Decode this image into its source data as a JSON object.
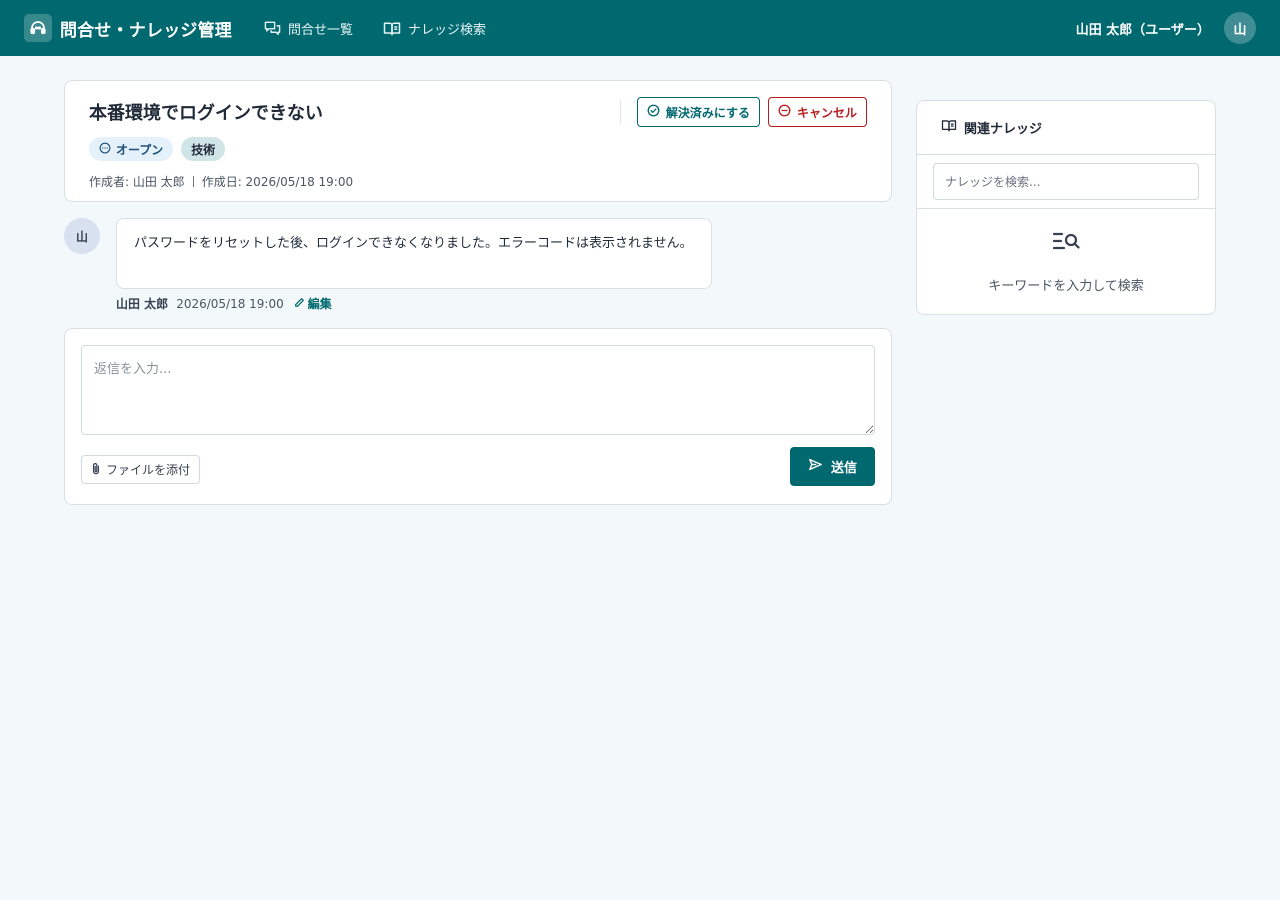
{
  "header": {
    "app_title": "問合せ・ナレッジ管理",
    "nav": [
      {
        "label": "問合せ一覧",
        "icon": "chat-bubbles-icon"
      },
      {
        "label": "ナレッジ検索",
        "icon": "open-book-icon"
      }
    ],
    "user_label": "山田 太郎（ユーザー）",
    "avatar_initial": "山"
  },
  "ticket": {
    "title": "本番環境でログインできない",
    "status_label": "オープン",
    "category_label": "技術",
    "author_meta": "作成者: 山田 太郎",
    "created_meta": "作成日: 2026/05/18 19:00",
    "resolve_label": "解決済みにする",
    "cancel_label": "キャンセル"
  },
  "message": {
    "avatar_initial": "山",
    "body": "パスワードをリセットした後、ログインできなくなりました。エラーコードは表示されません。",
    "author": "山田 太郎",
    "timestamp": "2026/05/18 19:00",
    "edit_label": "編集"
  },
  "reply": {
    "placeholder": "返信を入力...",
    "value": "",
    "attach_label": "ファイルを添付",
    "send_label": "送信"
  },
  "knowledge": {
    "title": "関連ナレッジ",
    "search_placeholder": "ナレッジを検索...",
    "empty_text": "キーワードを入力して検索"
  },
  "colors": {
    "primary": "#00686f",
    "danger": "#b91c1c",
    "status_badge_bg": "#e4f1fb",
    "category_badge_bg": "#cfe5e8",
    "page_bg": "#f3f8fa"
  }
}
